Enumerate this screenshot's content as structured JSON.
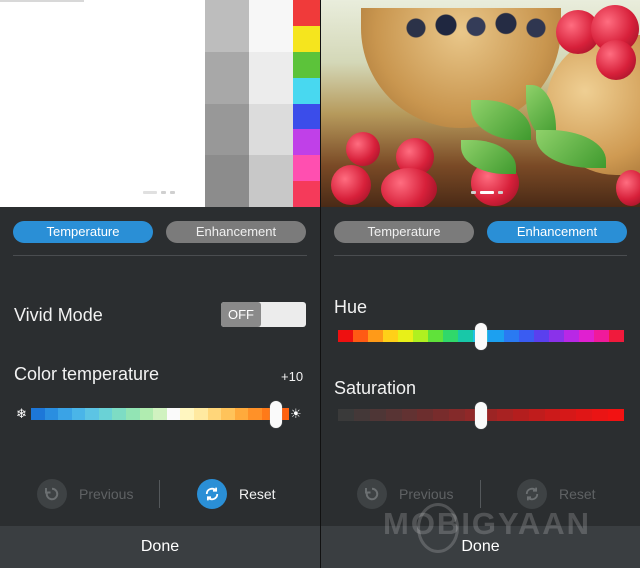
{
  "left_panel": {
    "tabs": [
      {
        "label": "Temperature",
        "active": true
      },
      {
        "label": "Enhancement",
        "active": false
      }
    ],
    "vivid_mode": {
      "label": "Vivid Mode",
      "toggle_text": "OFF",
      "state": "off"
    },
    "color_temperature": {
      "label": "Color temperature",
      "value": "+10",
      "level": 0.95,
      "cold_icon": "snowflake-icon",
      "warm_icon": "sun-icon"
    },
    "actions": {
      "previous": "Previous",
      "reset": "Reset",
      "previous_enabled": false,
      "reset_enabled": true
    },
    "done": "Done",
    "preview": {
      "gray_left": [
        "#bdbdbd",
        "#a8a8a8",
        "#989898",
        "#8c8c8c"
      ],
      "gray_right": [
        "#f7f7f7",
        "#ececec",
        "#dcdcdc",
        "#c8c8c8"
      ],
      "colors": [
        "#f03a3a",
        "#f5e51e",
        "#5cc33a",
        "#48d8f0",
        "#3b4dea",
        "#c040e8",
        "#ff4fb0",
        "#f53a5a"
      ]
    }
  },
  "right_panel": {
    "tabs": [
      {
        "label": "Temperature",
        "active": false
      },
      {
        "label": "Enhancement",
        "active": true
      }
    ],
    "hue": {
      "label": "Hue",
      "level": 0.5
    },
    "saturation": {
      "label": "Saturation",
      "level": 0.5
    },
    "actions": {
      "previous": "Previous",
      "reset": "Reset",
      "previous_enabled": false,
      "reset_enabled": false
    },
    "done": "Done"
  },
  "watermark": "MOBIGYAAN",
  "colors": {
    "accent": "#2a8fd6",
    "tab_inactive": "#7b7b7b",
    "panel_bg": "#2b2e30",
    "done_bar": "#3a3e41"
  },
  "temperature_gradient": [
    "#1d77d8",
    "#2a8ee0",
    "#3aa3e6",
    "#4ab5e8",
    "#5cc4e4",
    "#6ad2d6",
    "#7ddcc4",
    "#92e4b4",
    "#b0ecb0",
    "#d0f2c0",
    "#fafafa",
    "#fff6c0",
    "#ffe9a0",
    "#ffd67a",
    "#ffc35a",
    "#ffaa3c",
    "#ff9128",
    "#ff7a18",
    "#ff6210"
  ],
  "hue_gradient": [
    "#ee1010",
    "#ff5a14",
    "#ff9a18",
    "#ffd018",
    "#e8f018",
    "#b0f020",
    "#60e23a",
    "#30d86a",
    "#18c8a8",
    "#18c4e8",
    "#1ca0f0",
    "#2a7af2",
    "#3a5cf2",
    "#5a40ee",
    "#8a32ea",
    "#b828e6",
    "#e020d0",
    "#f01a9a",
    "#f01a3c"
  ],
  "saturation_gradient": [
    "#3a3a3a",
    "#443838",
    "#4e3636",
    "#583434",
    "#623232",
    "#6c2e2e",
    "#782c2c",
    "#842a2a",
    "#902828",
    "#9c2424",
    "#a82222",
    "#b41e1e",
    "#c01c1c",
    "#cc1a1a",
    "#d61818",
    "#e01616",
    "#ea1414",
    "#f21212"
  ]
}
